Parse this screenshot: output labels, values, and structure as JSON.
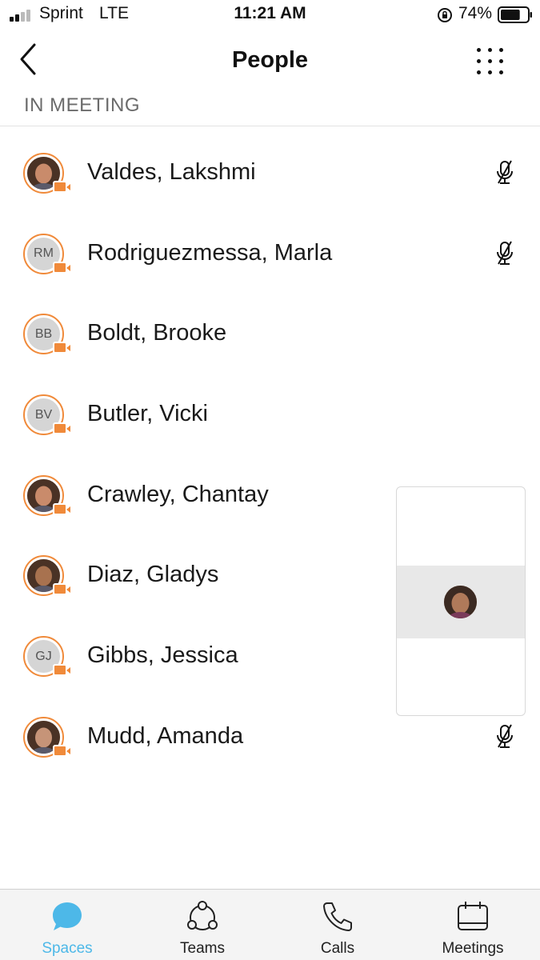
{
  "status_bar": {
    "carrier": "Sprint",
    "network": "LTE",
    "time": "11:21 AM",
    "battery_percent": "74%",
    "battery_level": 0.74
  },
  "nav": {
    "title": "People",
    "back_icon": "chevron-left-icon",
    "menu_icon": "grid-dots-icon"
  },
  "section": {
    "label": "IN MEETING"
  },
  "participants": [
    {
      "name": "Valdes, Lakshmi",
      "initials": "",
      "photo": true,
      "muted": true
    },
    {
      "name": "Rodriguezmessa, Marla",
      "initials": "RM",
      "photo": false,
      "muted": true
    },
    {
      "name": "Boldt, Brooke",
      "initials": "BB",
      "photo": false,
      "muted": false
    },
    {
      "name": "Butler, Vicki",
      "initials": "BV",
      "photo": false,
      "muted": false
    },
    {
      "name": "Crawley, Chantay",
      "initials": "",
      "photo": true,
      "muted": false
    },
    {
      "name": "Diaz, Gladys",
      "initials": "",
      "photo": true,
      "muted": false
    },
    {
      "name": "Gibbs, Jessica",
      "initials": "GJ",
      "photo": false,
      "muted": false
    },
    {
      "name": "Mudd, Amanda",
      "initials": "",
      "photo": true,
      "muted": true
    }
  ],
  "tabs": [
    {
      "label": "Spaces",
      "icon": "chat-bubble-icon",
      "active": true
    },
    {
      "label": "Teams",
      "icon": "teams-icon",
      "active": false
    },
    {
      "label": "Calls",
      "icon": "phone-icon",
      "active": false
    },
    {
      "label": "Meetings",
      "icon": "calendar-icon",
      "active": false
    }
  ],
  "colors": {
    "accent": "#4db8e8",
    "presence": "#f08a3a",
    "section_text": "#6b6b6b"
  }
}
